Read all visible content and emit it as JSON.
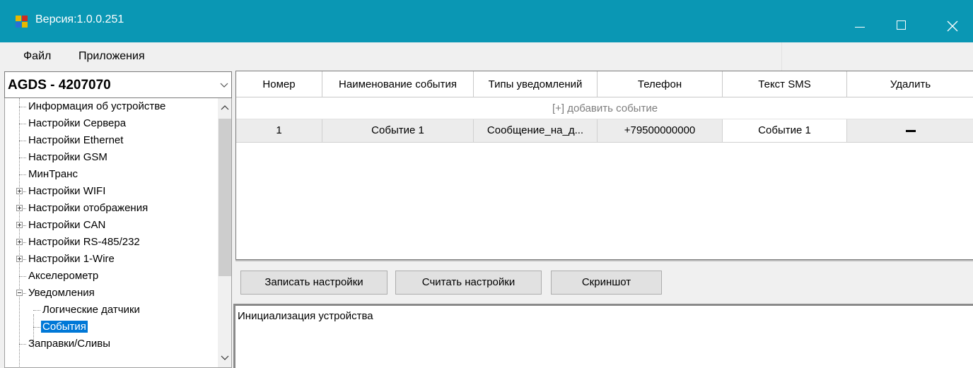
{
  "window": {
    "title": "Версия:1.0.0.251",
    "controls": {
      "minimize_icon": "minimize-icon",
      "maximize_icon": "maximize-icon",
      "close_icon": "close-icon"
    }
  },
  "menu": {
    "file": "Файл",
    "apps": "Приложения"
  },
  "device_selector": {
    "value": "AGDS - 4207070"
  },
  "tree": {
    "items": [
      {
        "label": "Информация об устройстве"
      },
      {
        "label": "Настройки Сервера"
      },
      {
        "label": "Настройки Ethernet"
      },
      {
        "label": "Настройки GSM"
      },
      {
        "label": "МинТранс"
      },
      {
        "label": "Настройки WIFI",
        "expander": "+"
      },
      {
        "label": "Настройки отображения",
        "expander": "+"
      },
      {
        "label": "Настройки CAN",
        "expander": "+"
      },
      {
        "label": "Настройки RS-485/232",
        "expander": "+"
      },
      {
        "label": "Настройки 1-Wire",
        "expander": "+"
      },
      {
        "label": "Акселерометр"
      },
      {
        "label": "Уведомления",
        "expander": "-"
      },
      {
        "label": "Логические датчики"
      },
      {
        "label": "События",
        "selected": true
      },
      {
        "label": "Заправки/Сливы"
      }
    ]
  },
  "grid": {
    "columns": [
      "Номер",
      "Наименование события",
      "Типы уведомлений",
      "Телефон",
      "Текст SMS",
      "Удалить"
    ],
    "add_row": "[+] добавить событие",
    "rows": [
      {
        "number": "1",
        "name": "Событие 1",
        "types": "Сообщение_на_д...",
        "phone": "+79500000000",
        "sms": "Событие 1",
        "delete_icon": "minus-icon"
      }
    ]
  },
  "buttons": {
    "write": "Записать настройки",
    "read": "Считать настройки",
    "screenshot": "Скриншот"
  },
  "log": {
    "text": "Инициализация устройства"
  },
  "colors": {
    "titlebar": "#0a97b4",
    "selection": "#0078d7"
  }
}
